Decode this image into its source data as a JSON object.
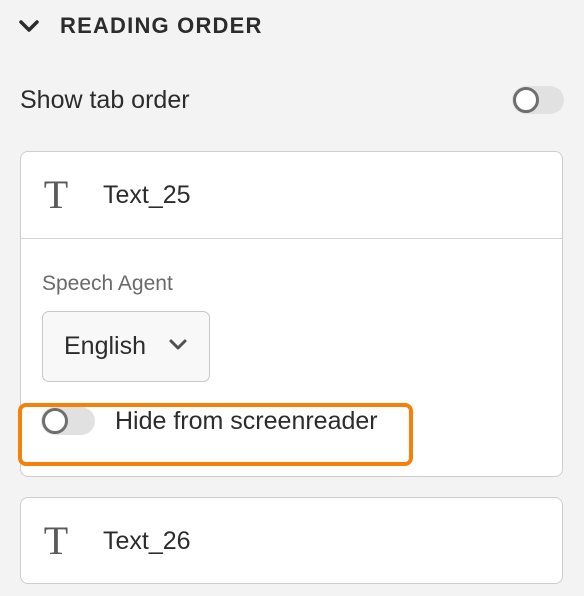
{
  "section": {
    "title": "READING ORDER",
    "expand_icon": "chevron-down-icon"
  },
  "tab_order": {
    "label": "Show tab order",
    "enabled": false
  },
  "items": [
    {
      "icon": "text-type-icon",
      "glyph": "T",
      "name": "Text_25",
      "expanded": true,
      "speech_agent": {
        "label": "Speech Agent",
        "value": "English"
      },
      "hide_from_screenreader": {
        "label": "Hide from screenreader",
        "enabled": false
      }
    },
    {
      "icon": "text-type-icon",
      "glyph": "T",
      "name": "Text_26",
      "expanded": false
    }
  ],
  "colors": {
    "highlight": "#f5800a",
    "panel_background": "#f3f3f3",
    "card_background": "#ffffff"
  }
}
